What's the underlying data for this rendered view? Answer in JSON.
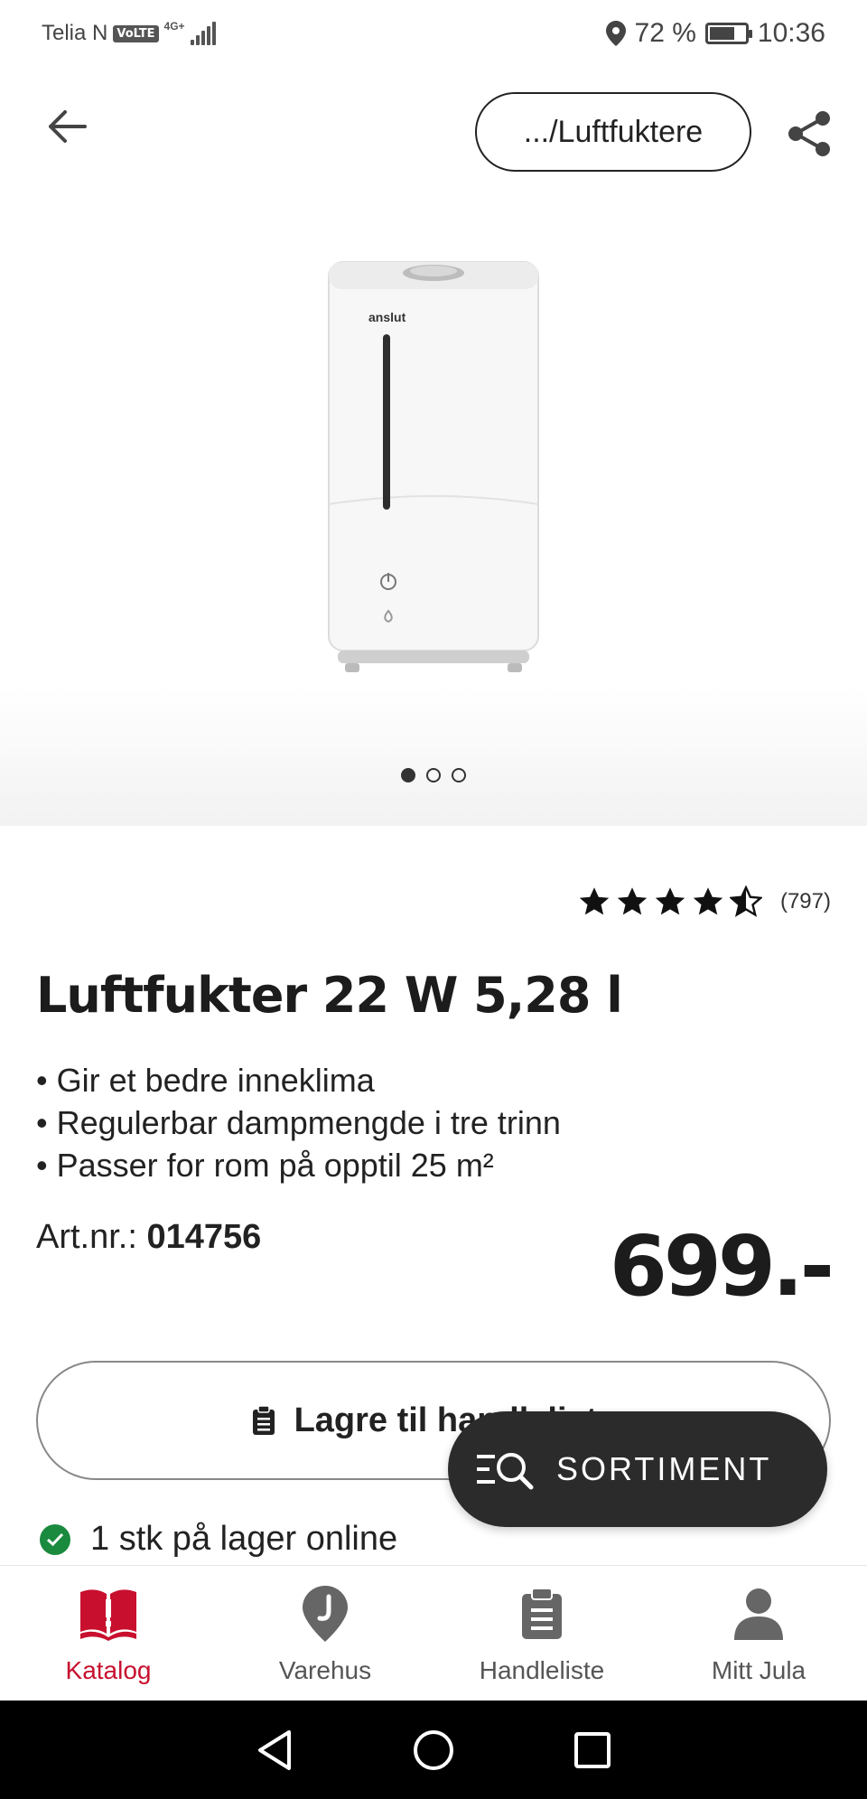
{
  "status_bar": {
    "carrier": "Telia N",
    "volte": "VoLTE",
    "network": "4G+",
    "battery": "72 %",
    "battery_level": 0.72,
    "time": "10:36"
  },
  "header": {
    "breadcrumb": ".../Luftfuktere"
  },
  "gallery": {
    "brand": "anslut",
    "image_count": 3,
    "active_index": 0
  },
  "product": {
    "rating_stars": 4.5,
    "review_count": "(797)",
    "title": "Luftfukter 22 W 5,28 l",
    "bullets": [
      "• Gir et bedre inneklima",
      "• Regulerbar dampmengde i tre trinn",
      "• Passer for rom på opptil 25 m²"
    ],
    "artnr_label": "Art.nr.:",
    "artnr_value": "014756",
    "price": "699.-",
    "save_label": "Lagre til handleliste",
    "stock_text": "1 stk på lager online"
  },
  "fab": {
    "label": "SORTIMENT"
  },
  "bottom_nav": {
    "items": [
      {
        "label": "Katalog",
        "icon": "catalog-book-icon"
      },
      {
        "label": "Varehus",
        "icon": "store-pin-icon"
      },
      {
        "label": "Handleliste",
        "icon": "clipboard-icon"
      },
      {
        "label": "Mitt Jula",
        "icon": "user-icon"
      }
    ],
    "active": "Katalog"
  },
  "colors": {
    "accent": "#c8102e",
    "fab": "#2b2b2b",
    "stock_ok": "#1a8a3e"
  }
}
